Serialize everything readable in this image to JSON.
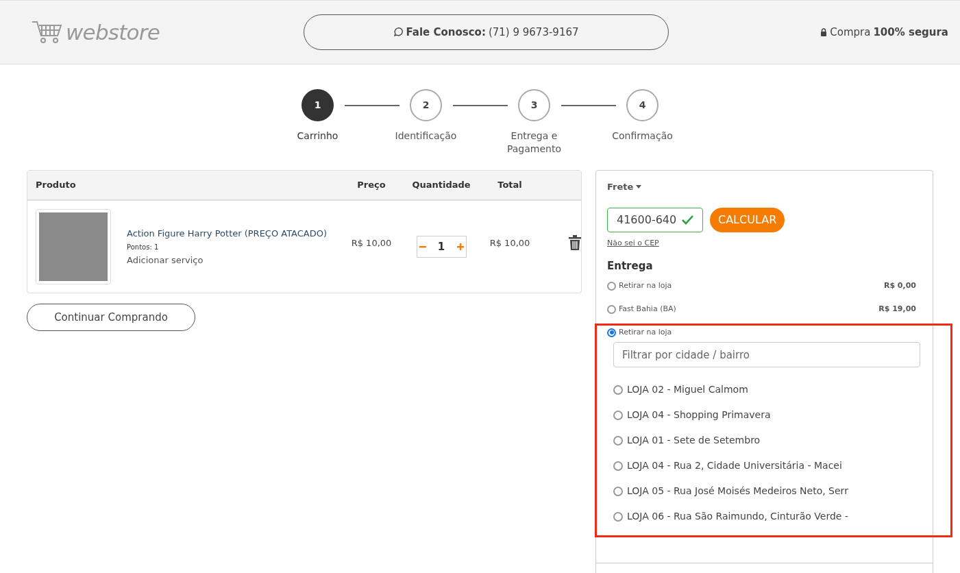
{
  "header": {
    "logo": "webstore",
    "contact_label": "Fale Conosco:",
    "contact_phone": "(71) 9 9673-9167",
    "secure_prefix": "Compra",
    "secure_bold": "100% segura"
  },
  "steps": [
    {
      "number": "1",
      "label": "Carrinho",
      "selected": true
    },
    {
      "number": "2",
      "label": "Identificação",
      "selected": false
    },
    {
      "number": "3",
      "label": "Entrega e Pagamento",
      "selected": false
    },
    {
      "number": "4",
      "label": "Confirmação",
      "selected": false
    }
  ],
  "cart": {
    "columns": [
      "Produto",
      "Preço",
      "Quantidade",
      "Total"
    ],
    "rows": [
      {
        "name": "Action Figure Harry Potter (PREÇO ATACADO)",
        "points": "Pontos: 1",
        "service": "Adicionar serviço",
        "price": "R$ 10,00",
        "quantity": "1",
        "total": "R$ 10,00"
      }
    ]
  },
  "continue_button": "Continuar Comprando",
  "shipping": {
    "title": "Frete",
    "cep": "41600-640",
    "cep_valid": true,
    "calculate_button": "CALCULAR",
    "cep_help": "Não sei o CEP",
    "delivery_title": "Entrega",
    "options": [
      {
        "label": "Retirar na loja",
        "price": "R$ 0,00",
        "selected": false
      },
      {
        "label": "Fast Bahia (BA)",
        "price": "R$ 19,00",
        "selected": false
      },
      {
        "label": "Retirar na loja",
        "selected": true,
        "filter_placeholder": "Filtrar por cidade / bairro",
        "stores": [
          {
            "label": "LOJA 02 - Miguel Calmom",
            "selected": false
          },
          {
            "label": "LOJA 04 - Shopping Primavera",
            "selected": false
          },
          {
            "label": "LOJA 01 - Sete de Setembro",
            "selected": false
          },
          {
            "label": "LOJA 04 - Rua 2, Cidade Universitária - Macei",
            "selected": false
          },
          {
            "label": "LOJA 05 - Rua José Moisés Medeiros Neto, Serr",
            "selected": false
          },
          {
            "label": "LOJA 06 - Rua São Raimundo, Cinturão Verde -",
            "selected": false
          }
        ]
      }
    ]
  }
}
